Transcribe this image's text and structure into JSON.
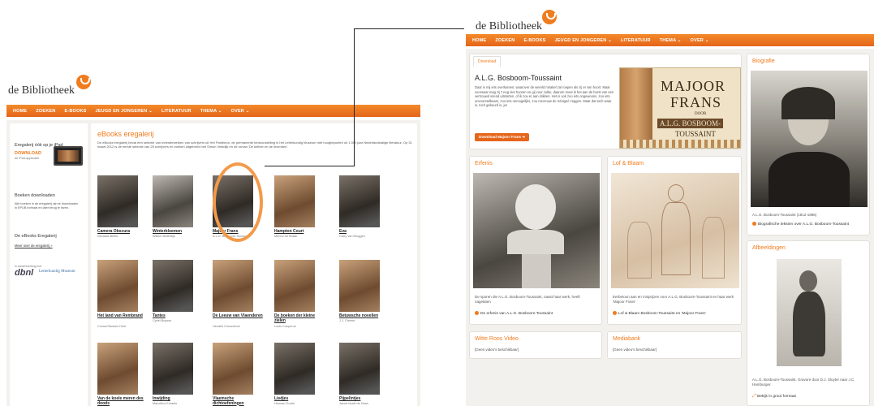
{
  "left": {
    "logo": "de Bibliotheek",
    "nav": [
      "HOME",
      "ZOEKEN",
      "E-BOOKS",
      "JEUGD EN JONGEREN ⌄",
      "LITERATUUR",
      "THEMA ⌄",
      "OVER ⌄"
    ],
    "sidebar": {
      "ipad_title": "Eregalerij óók op je iPad",
      "download_label": "DOWNLOAD",
      "download_sub": "de iPad-applicatie",
      "books_title": "Boeken downloaden",
      "books_text": "Alle boeken in de eregalerij zijn te downloaden in EPUB formaat en later terug te lezen.",
      "ebooks_title": "De eBooks Eregalerij",
      "more_link": "Meer over de eregalerij »",
      "partner_label": "In samenwerking met",
      "dbnl": "dbnl",
      "lm": "Letterkundig Museum"
    },
    "main": {
      "title": "eBooks eregalerij",
      "intro": "De eBooks eregalerij bevat een selectie van meesterwerken van schrijvers uit Het Pantheon, de permanente tentoonstelling in het Letterkundig Museum met hoogtepunten uit 1.000 jaar Nederlandstalige literatuur. Op 31 maart 2012 is de eerste selectie van 25 schrijvers en boeken uitgebreid met Simon Vestdijk en de roman 'De kellner en de levenden'.",
      "books": [
        {
          "title": "Camera Obscura",
          "author": "Nicolaas Beets"
        },
        {
          "title": "Winterbloemen",
          "author": "Willem Bilderdijk"
        },
        {
          "title": "Majoor Frans",
          "author": "A.L.G. Bosboom-Toussaint"
        },
        {
          "title": "Hampton Court",
          "author": "Menno ter Braak"
        },
        {
          "title": "Eva",
          "author": "Carry van Bruggen"
        },
        {
          "title": "Het land van Rembrand",
          "author": "Conrad Busken Huet"
        },
        {
          "title": "Tantes",
          "author": "Cyriel Buysse"
        },
        {
          "title": "De Leeuw van Vlaenderen",
          "author": "Hendrik Conscience"
        },
        {
          "title": "De boeken der kleine zielen",
          "author": "Louis Couperus"
        },
        {
          "title": "Betuwsche novellen",
          "author": "J.J. Cremer"
        },
        {
          "title": "Van de koele meren des doods",
          "author": ""
        },
        {
          "title": "Inwijding",
          "author": "Marcellus Emants"
        },
        {
          "title": "Vlaemsche dichtoefeningen",
          "author": ""
        },
        {
          "title": "Liedjes",
          "author": "Herman Gorter"
        },
        {
          "title": "Pijpelintjes",
          "author": "Jacob Israël de Haan"
        }
      ]
    }
  },
  "right": {
    "logo": "de Bibliotheek",
    "nav": [
      "HOME",
      "ZOEKEN",
      "E-BOOKS",
      "JEUGD EN JONGEREN ⌄",
      "LITERATUUR",
      "THEMA ⌄",
      "OVER ⌄"
    ],
    "download": {
      "tab": "Download",
      "title": "A.L.G. Bosboom-Toussaint",
      "text": "Daar is mij iets overkomen, waarover de wereld mirakel zal roepen als zij er van hoort. Maar voorwaar mag zij 't nog niet hooren en gij voor zulke, daarom moet ik het aan de borst van een vertrouwd vriend uitstorten, of ik zou er aan stikken. Het is ook zoo iets ongewoons, zoo iets onvoorstelbaars, zoo iets onmogelijks, zou mevrouw de Sévigné zeggen. Maar dat toch waar is, toch gebeurd is, ja!",
      "button": "Download Majoor Frans ➔",
      "cover": [
        "MAJOOR",
        "FRANS",
        "DOOR",
        "A.L.G. BOSBOOM-",
        "TOUSSAINT"
      ]
    },
    "biografie": {
      "title": "Biografie",
      "caption": "A.L.G. Bosboom-Toussaint (1812-1886)",
      "link": "Biografische teksten over A.L.G. Bosboom-Toussaint"
    },
    "erfenis": {
      "title": "Erfenis",
      "caption": "De sporen die A.L.G. Bosboom-Toussaint, naast haar werk, heeft nagelaten",
      "link": "De erfenis van A.L.G. Bosboom-Toussaint"
    },
    "lof": {
      "title": "Lof & Blaam",
      "caption": "Eerbetoon aan en misprijzen voor A.L.G. Bosboom-Toussaint en haar werk 'Majoor Frans'",
      "link": "Lof & Blaam Bosboom-Toussaint en 'Majoor Frans'"
    },
    "afbeeldingen": {
      "title": "Afbeeldingen",
      "caption": "A.L.G. Bosboom-Toussaint. Gravure door D.J. Sluyter naar J.C. Hamburger.",
      "link": "Bekijk in groot formaat"
    },
    "video": {
      "title": "Witte Roos Video",
      "text": "[Geen video's beschikbaar]"
    },
    "mediabank": {
      "title": "Mediabank",
      "text": "[Geen video's beschikbaar]"
    }
  },
  "colors": {
    "accent": "#f07c1e",
    "nav": "#e86b1c"
  }
}
